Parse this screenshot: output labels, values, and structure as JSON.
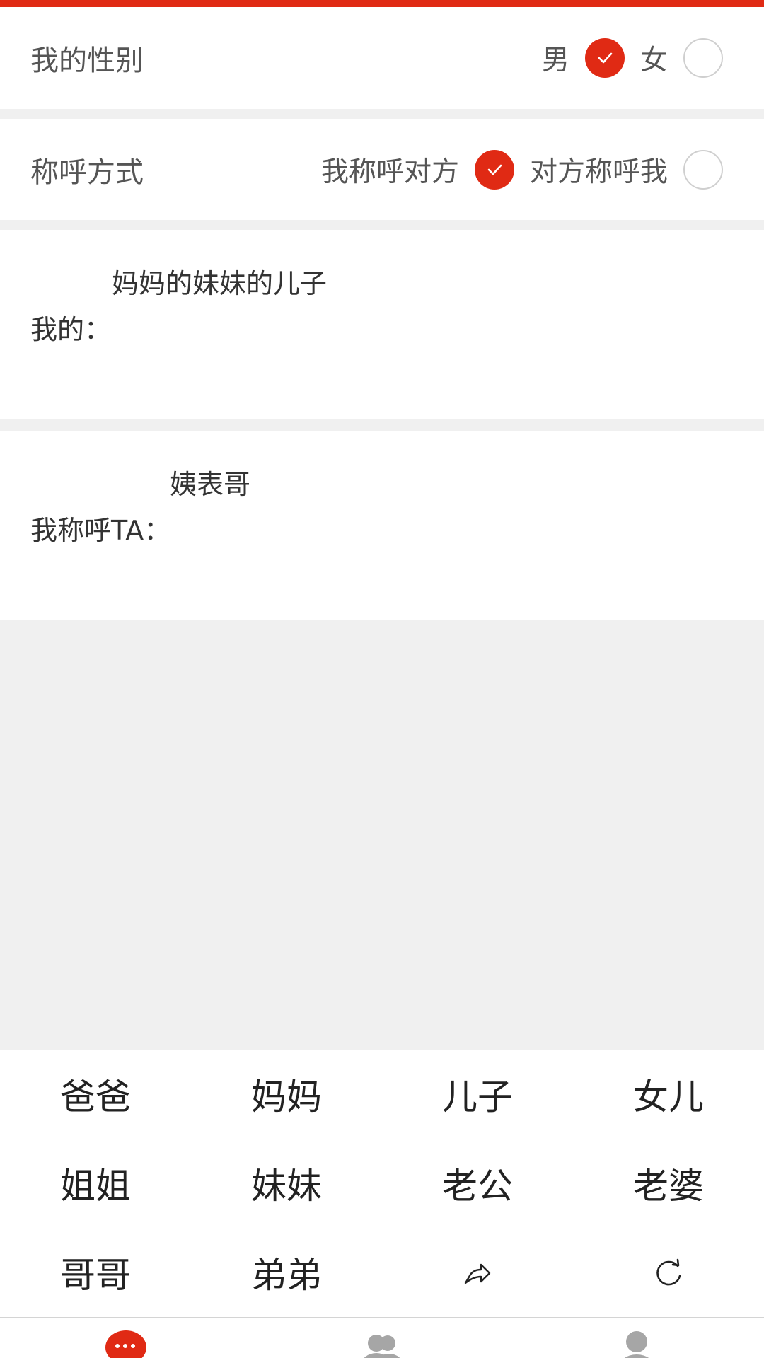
{
  "gender": {
    "label": "我的性别",
    "options": [
      {
        "label": "男",
        "selected": true
      },
      {
        "label": "女",
        "selected": false
      }
    ]
  },
  "address_mode": {
    "label": "称呼方式",
    "options": [
      {
        "label": "我称呼对方",
        "selected": true
      },
      {
        "label": "对方称呼我",
        "selected": false
      }
    ]
  },
  "relation": {
    "label": "我的：",
    "expression": "妈妈的妹妹的儿子"
  },
  "result": {
    "label": "我称呼TA：",
    "value": "姨表哥"
  },
  "keypad": {
    "keys": [
      "爸爸",
      "妈妈",
      "儿子",
      "女儿",
      "姐姐",
      "妹妹",
      "老公",
      "老婆",
      "哥哥",
      "弟弟"
    ],
    "back_icon": "back-arrow-icon",
    "reset_icon": "refresh-icon"
  },
  "tabbar": {
    "icons": [
      "chat-bubble-icon",
      "group-icon",
      "person-icon"
    ],
    "active_index": 0
  },
  "colors": {
    "accent": "#e02a14",
    "inactive_icon": "#a6a6a6",
    "background": "#f0f0f0"
  }
}
